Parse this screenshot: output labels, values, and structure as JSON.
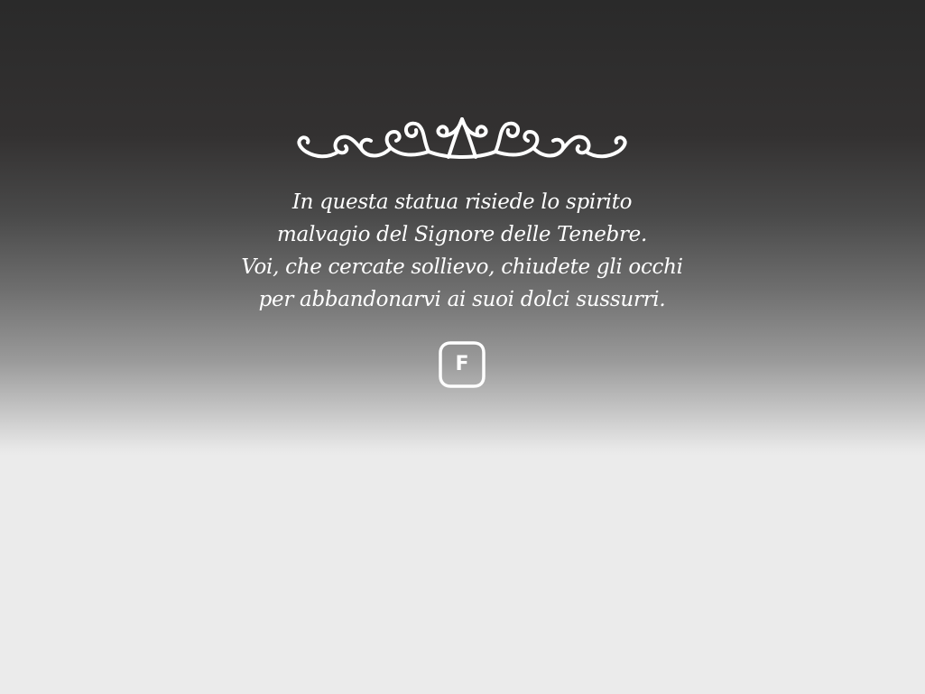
{
  "dialog": {
    "ornament_icon": "flourish-divider-icon",
    "lines": [
      "In questa statua risiede lo spirito",
      "malvagio del Signore delle Tenebre.",
      "Voi, che cercate sollievo, chiudete gli occhi",
      "per abbandonarvi ai suoi dolci sussurri."
    ],
    "key_prompt": "F"
  },
  "colors": {
    "text": "#ffffff",
    "background_top": "#2a2a2a",
    "background_bottom": "#ebebeb"
  }
}
